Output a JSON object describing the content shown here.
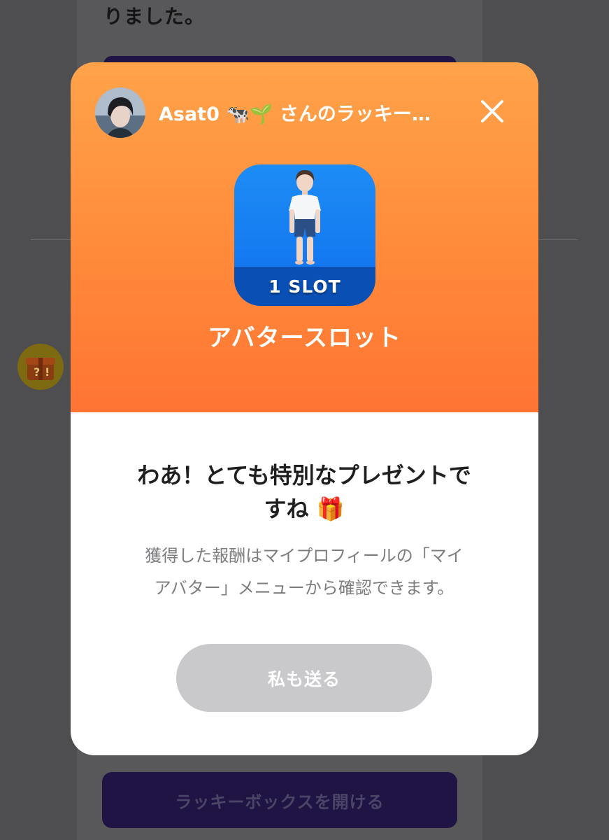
{
  "background": {
    "partial_text": "りました。",
    "open_box_button_label": "ラッキーボックスを開ける"
  },
  "modal": {
    "sender_title": "Asat0 🐄🌱 さんのラッキー…",
    "item": {
      "badge_label": "1 SLOT",
      "name": "アバタースロット"
    },
    "headline_line1": "わあ！とても特別なプレゼントで",
    "headline_line2": "すね",
    "headline_emoji": "🎁",
    "description_line1": "獲得した報酬はマイプロフィールの「マイ",
    "description_line2": "アバター」メニューから確認できます。",
    "send_button_label": "私も送る"
  },
  "icons": [
    "avatar",
    "close-icon",
    "avatar-figure-icon",
    "gift-icon",
    "mystery-gift-icon"
  ],
  "colors": {
    "header_gradient_top": "#ffa34a",
    "header_gradient_bottom": "#ff7433",
    "slot_tile": "#1580f2",
    "send_button_disabled": "#c9c9cc",
    "background_button": "#1f1443"
  }
}
